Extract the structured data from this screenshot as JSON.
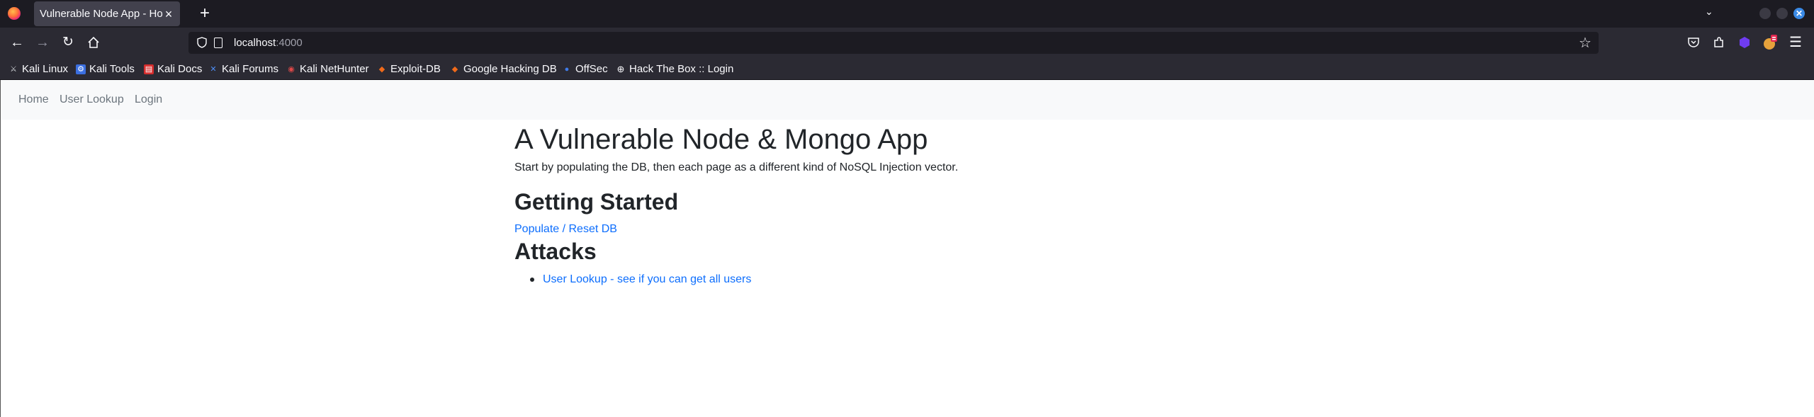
{
  "browser": {
    "tab_title": "Vulnerable Node App - Home",
    "tab_close": "×",
    "new_tab": "+",
    "url_host": "localhost",
    "url_port": ":4000",
    "bookmarks": [
      {
        "label": "Kali Linux",
        "icon": "kali-dragon-icon"
      },
      {
        "label": "Kali Tools",
        "icon": "kali-tools-icon"
      },
      {
        "label": "Kali Docs",
        "icon": "kali-docs-icon"
      },
      {
        "label": "Kali Forums",
        "icon": "kali-forums-icon"
      },
      {
        "label": "Kali NetHunter",
        "icon": "nethunter-icon"
      },
      {
        "label": "Exploit-DB",
        "icon": "exploit-db-icon"
      },
      {
        "label": "Google Hacking DB",
        "icon": "ghdb-icon"
      },
      {
        "label": "OffSec",
        "icon": "offsec-icon"
      },
      {
        "label": "Hack The Box :: Login",
        "icon": "globe-icon"
      }
    ]
  },
  "site_nav": {
    "home": "Home",
    "user_lookup": "User Lookup",
    "login": "Login"
  },
  "content": {
    "title": "A Vulnerable Node & Mongo App",
    "lead": "Start by populating the DB, then each page as a different kind of NoSQL Injection vector.",
    "getting_started": "Getting Started",
    "populate_link": "Populate / Reset DB",
    "attacks_heading": "Attacks",
    "attacks": [
      "User Lookup - see if you can get all users"
    ]
  },
  "colors": {
    "tabbar_bg": "#1c1b22",
    "toolbar_bg": "#2b2a33",
    "link": "#0d6efd",
    "nav_text": "#6c757d",
    "nav_bg": "#f8f9fa"
  }
}
